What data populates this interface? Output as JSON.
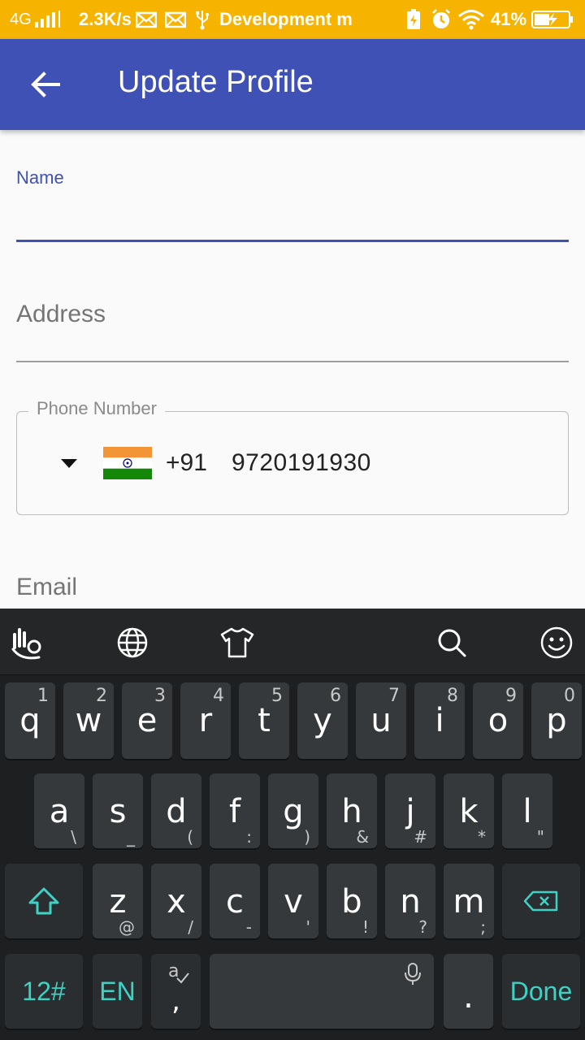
{
  "status_bar": {
    "network": "4G",
    "speed": "2.3K/s",
    "notification": "Development m",
    "battery_percent": "41%"
  },
  "app_bar": {
    "title": "Update Profile"
  },
  "form": {
    "name_label": "Name",
    "name_value": "",
    "address_label": "Address",
    "phone_label": "Phone Number",
    "country_code": "+91",
    "phone_value": "9720191930",
    "email_label": "Email"
  },
  "keyboard": {
    "row1": [
      {
        "key": "q",
        "alt": "1"
      },
      {
        "key": "w",
        "alt": "2"
      },
      {
        "key": "e",
        "alt": "3"
      },
      {
        "key": "r",
        "alt": "4"
      },
      {
        "key": "t",
        "alt": "5"
      },
      {
        "key": "y",
        "alt": "6"
      },
      {
        "key": "u",
        "alt": "7"
      },
      {
        "key": "i",
        "alt": "8"
      },
      {
        "key": "o",
        "alt": "9"
      },
      {
        "key": "p",
        "alt": "0"
      }
    ],
    "row2": [
      {
        "key": "a",
        "alt": "\\"
      },
      {
        "key": "s",
        "alt": "_"
      },
      {
        "key": "d",
        "alt": "("
      },
      {
        "key": "f",
        "alt": ":"
      },
      {
        "key": "g",
        "alt": ")"
      },
      {
        "key": "h",
        "alt": "&"
      },
      {
        "key": "j",
        "alt": "#"
      },
      {
        "key": "k",
        "alt": "*"
      },
      {
        "key": "l",
        "alt": "\""
      }
    ],
    "row3": [
      {
        "key": "z",
        "alt": "@"
      },
      {
        "key": "x",
        "alt": "/"
      },
      {
        "key": "c",
        "alt": "-"
      },
      {
        "key": "v",
        "alt": "'"
      },
      {
        "key": "b",
        "alt": "!"
      },
      {
        "key": "n",
        "alt": "?"
      },
      {
        "key": "m",
        "alt": ";"
      }
    ],
    "numbers_key": "12#",
    "language_key": "EN",
    "comma_key": ",",
    "period_key": ".",
    "done_key": "Done"
  }
}
